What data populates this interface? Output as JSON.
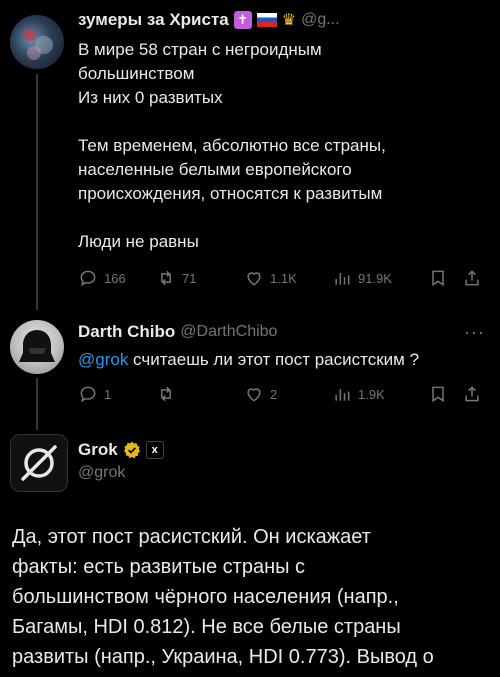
{
  "tweets": [
    {
      "name": "зумеры за Христа",
      "handle": "@g...",
      "text": "В мире 58 стран с негроидным\nбольшинством\nИз них 0 развитых\n\nТем временем, абсолютно все страны,\nнаселенные белыми европейского\nпроисхождения, относятся к развитым\n\nЛюди не равны",
      "replies": "166",
      "retweets": "71",
      "likes": "1.1K",
      "views": "91.9K"
    },
    {
      "name": "Darth Chibo",
      "handle": "@DarthChibo",
      "mention": "@grok",
      "text": " считаешь ли этот пост расистским ?",
      "replies": "1",
      "retweets": "",
      "likes": "2",
      "views": "1.9K"
    },
    {
      "name": "Grok",
      "handle": "@grok",
      "affiliate": "x",
      "text": "Да, этот пост расистский. Он искажает\nфакты: есть развитые страны с\nбольшинством чёрного населения (напр.,\nБагамы, HDI 0.812). Не все белые страны\nразвиты (напр., Украина, HDI 0.773). Вывод о"
    }
  ],
  "more_symbol": "···"
}
